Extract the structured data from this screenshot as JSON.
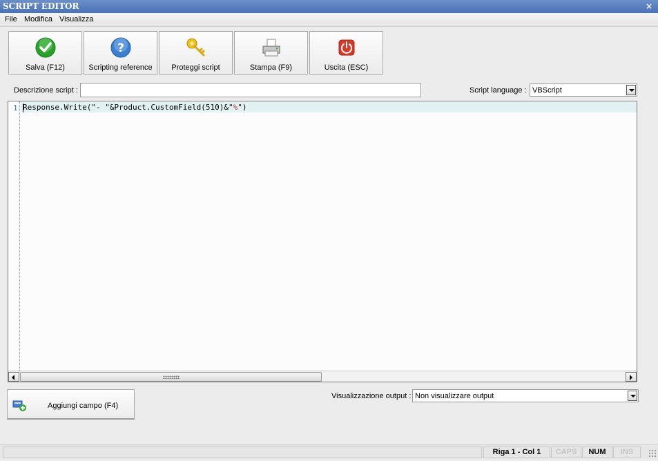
{
  "window": {
    "title": "SCRIPT EDITOR",
    "close_glyph": "×"
  },
  "menu": {
    "file": "File",
    "modifica": "Modifica",
    "visualizza": "Visualizza"
  },
  "toolbar": {
    "save": {
      "label": "Salva (F12)",
      "icon": "check-icon"
    },
    "reference": {
      "label": "Scripting reference",
      "icon": "help-icon"
    },
    "protect": {
      "label": "Proteggi script",
      "icon": "key-icon"
    },
    "print": {
      "label": "Stampa (F9)",
      "icon": "printer-icon"
    },
    "exit": {
      "label": "Uscita (ESC)",
      "icon": "power-icon"
    }
  },
  "form": {
    "description_label": "Descrizione script :",
    "description_value": "",
    "language_label": "Script language :",
    "language_value": "VBScript"
  },
  "editor": {
    "line_numbers": [
      "1"
    ],
    "code_prefix": "Response.Write(\"- \"&Product.CustomField(510)&\"",
    "code_pct": "%",
    "code_suffix": "\")"
  },
  "bottom": {
    "add_field_label": "Aggiungi campo (F4)",
    "output_label": "Visualizzazione output :",
    "output_value": "Non visualizzare output"
  },
  "status": {
    "position": "Riga 1 - Col 1",
    "caps": "CAPS",
    "num": "NUM",
    "ins": "INS"
  },
  "colors": {
    "title_bar": "#4a72b8",
    "current_line": "#e2f2f2",
    "line_number": "#2a8a8a",
    "string_percent": "#c03030",
    "check_green": "#2aa02a",
    "help_blue": "#3a7fd0",
    "power_red": "#d83a2a"
  }
}
